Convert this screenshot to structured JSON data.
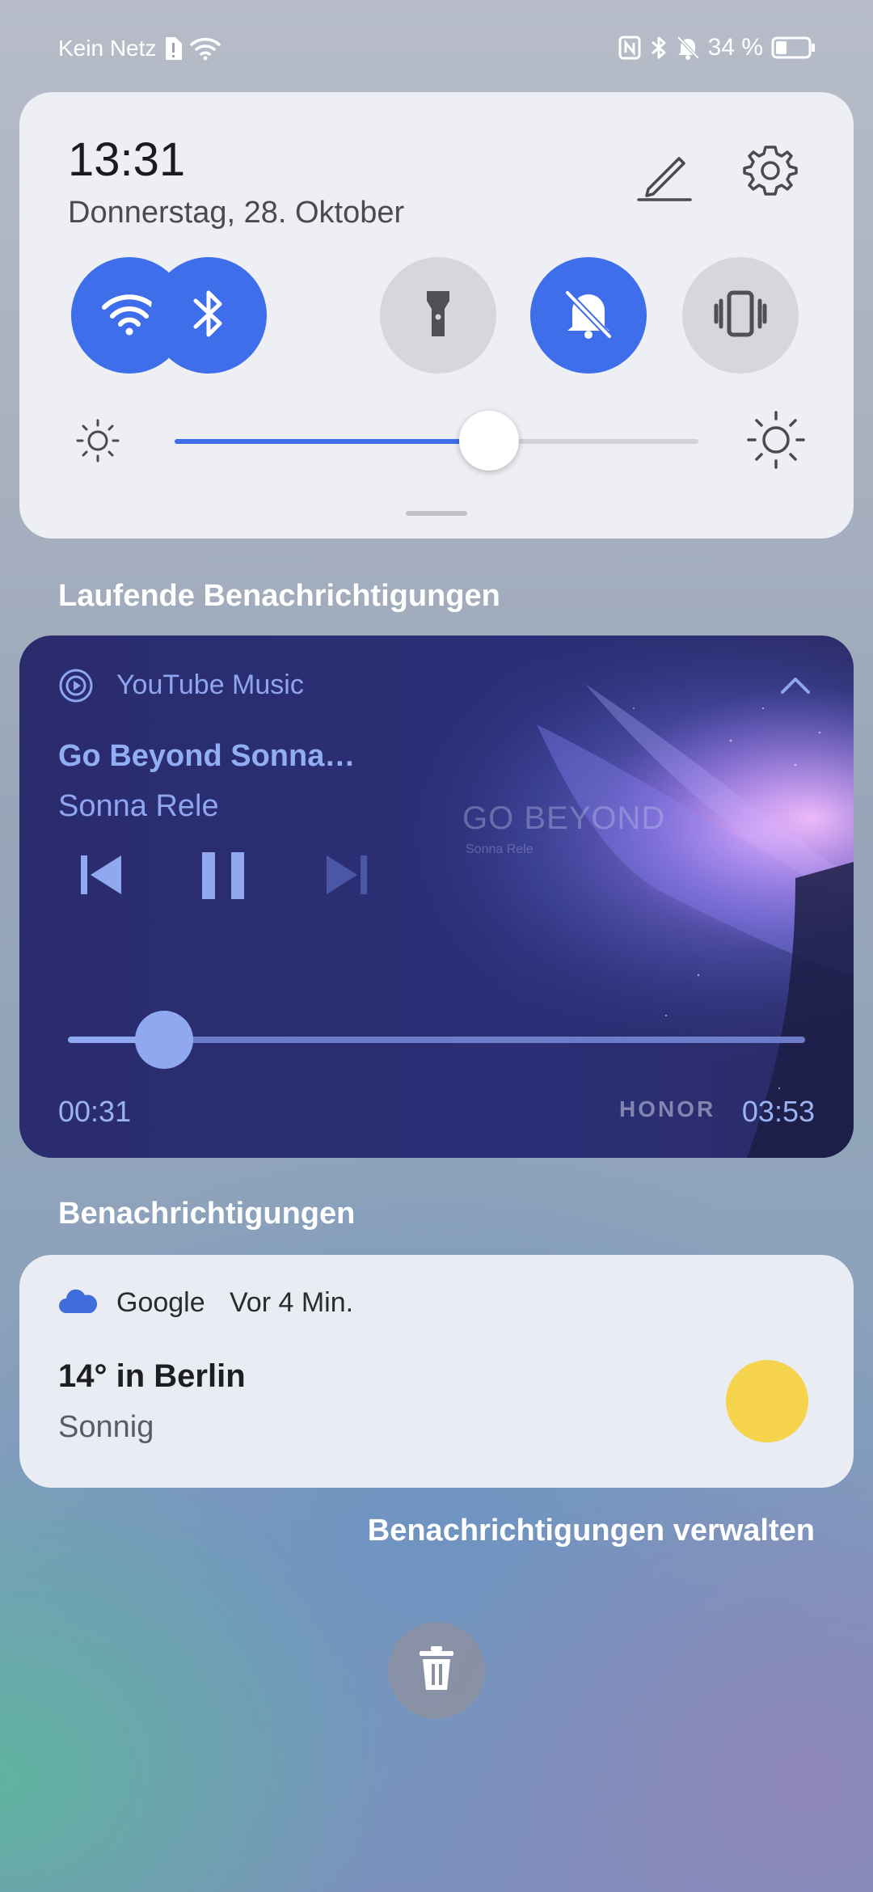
{
  "status_bar": {
    "carrier": "Kein Netz",
    "battery": "34 %",
    "icons": [
      "sim-alert-icon",
      "wifi-icon",
      "nfc-icon",
      "bluetooth-icon",
      "mute-icon",
      "battery-icon"
    ]
  },
  "quick_settings": {
    "time": "13:31",
    "date": "Donnerstag, 28. Oktober",
    "toggles": [
      {
        "name": "wifi",
        "icon": "wifi-icon",
        "state": "on"
      },
      {
        "name": "bluetooth",
        "icon": "bluetooth-icon",
        "state": "on"
      },
      {
        "name": "flashlight",
        "icon": "flashlight-icon",
        "state": "off"
      },
      {
        "name": "silent",
        "icon": "bell-off-icon",
        "state": "on"
      },
      {
        "name": "vibration",
        "icon": "vibrate-icon",
        "state": "off"
      }
    ],
    "brightness_percent": 60,
    "accent_color": "#3e6ee9"
  },
  "sections": {
    "ongoing_title": "Laufende Benachrichtigungen",
    "notifications_title": "Benachrichtigungen",
    "manage_label": "Benachrichtigungen verwalten"
  },
  "media": {
    "app": "YouTube Music",
    "title": "Go Beyond Sonna…",
    "artist": "Sonna Rele",
    "current_time": "00:31",
    "duration": "03:53",
    "progress_percent": 13,
    "art_text": "GO BEYOND",
    "art_subtext": "Sonna Rele",
    "art_brand": "HONOR",
    "state": "playing"
  },
  "notification": {
    "app": "Google",
    "time": "Vor 4 Min.",
    "title": "14° in Berlin",
    "body": "Sonnig",
    "icon": "cloud-icon",
    "weather_icon": "sun-icon"
  }
}
